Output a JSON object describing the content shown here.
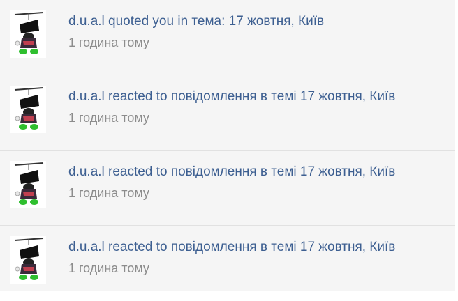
{
  "notifications": [
    {
      "title": "d.u.a.l quoted you in тема: 17 жовтня, Київ",
      "time": "1 година тому",
      "avatar_icon": "user-avatar-icon"
    },
    {
      "title": "d.u.a.l reacted to повідомлення в темі 17 жовтня, Київ",
      "time": "1 година тому",
      "avatar_icon": "user-avatar-icon"
    },
    {
      "title": "d.u.a.l reacted to повідомлення в темі 17 жовтня, Київ",
      "time": "1 година тому",
      "avatar_icon": "user-avatar-icon"
    },
    {
      "title": "d.u.a.l reacted to повідомлення в темі 17 жовтня, Київ",
      "time": "1 година тому",
      "avatar_icon": "user-avatar-icon"
    }
  ],
  "colors": {
    "link": "#3d5f91",
    "muted": "#8c8c8c",
    "background": "#f5f5f5",
    "separator": "#e1e1e1"
  }
}
